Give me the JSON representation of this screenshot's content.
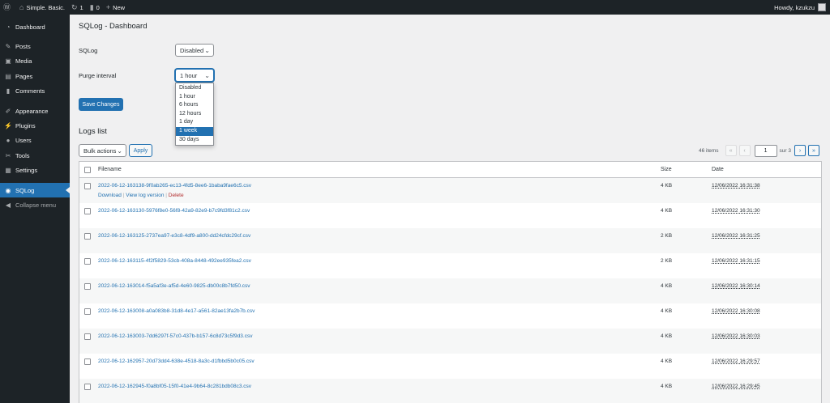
{
  "adminbar": {
    "wp_logo_icon": "wordpress-icon",
    "site_name": "Simple. Basic.",
    "updates_count": "1",
    "comments_count": "0",
    "new_label": "New",
    "howdy": "Howdy, kzukzu"
  },
  "sidebar": {
    "items": [
      {
        "label": "Dashboard",
        "icon": "dashboard-icon"
      },
      {
        "label": "Posts",
        "icon": "pin-icon"
      },
      {
        "label": "Media",
        "icon": "media-icon"
      },
      {
        "label": "Pages",
        "icon": "pages-icon"
      },
      {
        "label": "Comments",
        "icon": "comment-icon"
      },
      {
        "label": "Appearance",
        "icon": "brush-icon"
      },
      {
        "label": "Plugins",
        "icon": "plugin-icon"
      },
      {
        "label": "Users",
        "icon": "users-icon"
      },
      {
        "label": "Tools",
        "icon": "wrench-icon"
      },
      {
        "label": "Settings",
        "icon": "settings-icon"
      },
      {
        "label": "SQLog",
        "icon": "database-icon",
        "active": true
      },
      {
        "label": "Collapse menu",
        "icon": "collapse-icon"
      }
    ]
  },
  "page": {
    "title": "SQLog - Dashboard",
    "sqlog_label": "SQLog",
    "sqlog_value": "Disabled",
    "purge_label": "Purge interval",
    "purge_value": "1 hour",
    "purge_options": [
      "Disabled",
      "1 hour",
      "6 hours",
      "12 hours",
      "1 day",
      "1 week",
      "30 days"
    ],
    "purge_highlighted": "1 week",
    "save_label": "Save Changes",
    "logs_title": "Logs list"
  },
  "tablenav": {
    "bulk_actions": "Bulk actions",
    "apply": "Apply",
    "items_count": "46 items",
    "first": "«",
    "prev": "‹",
    "current_page": "1",
    "of_pages": "sur 3",
    "next": "›",
    "last": "»"
  },
  "table": {
    "headers": {
      "filename": "Filename",
      "size": "Size",
      "date": "Date"
    },
    "row_actions": {
      "download": "Download",
      "view": "View log version",
      "delete": "Delete",
      "sep": "|"
    },
    "rows": [
      {
        "filename": "2022-06-12-163138-9f0ab265-ec13-4fd5-8ee6-1baba9fae6c5.csv",
        "size": "4 KB",
        "date": "12/06/2022 16:31:38"
      },
      {
        "filename": "2022-06-12-163130-5976f8e0-56f8-42a9-82e9-b7c9fd3f81c2.csv",
        "size": "4 KB",
        "date": "12/06/2022 16:31:30"
      },
      {
        "filename": "2022-06-12-163125-2737ea97-e3c8-4df9-a800-dd24cfdc29cf.csv",
        "size": "2 KB",
        "date": "12/06/2022 16:31:25"
      },
      {
        "filename": "2022-06-12-163115-4f2f5829-53cb-408a-8448-492ee935fea2.csv",
        "size": "2 KB",
        "date": "12/06/2022 16:31:15"
      },
      {
        "filename": "2022-06-12-163014-f5a5af3e-af5d-4e60-9825-db00c8b7fd50.csv",
        "size": "4 KB",
        "date": "12/06/2022 16:30:14"
      },
      {
        "filename": "2022-06-12-163008-a0a083b8-31d8-4e17-a561-82ae13fa2b7b.csv",
        "size": "4 KB",
        "date": "12/06/2022 16:30:08"
      },
      {
        "filename": "2022-06-12-163003-7dd6297f-57c0-437b-b157-6c8d73c5f9d3.csv",
        "size": "4 KB",
        "date": "12/06/2022 16:30:03"
      },
      {
        "filename": "2022-06-12-162957-20d73dd4-638e-4518-8a3c-d1fbbd5b0c05.csv",
        "size": "4 KB",
        "date": "12/06/2022 16:29:57"
      },
      {
        "filename": "2022-06-12-162945-f0a8bf05-15f0-41e4-9b64-8c281bdb08c3.csv",
        "size": "4 KB",
        "date": "12/06/2022 16:29:45"
      }
    ]
  },
  "colors": {
    "accent": "#2271b1",
    "admin_bg": "#1d2327",
    "delete": "#b32d2e"
  }
}
